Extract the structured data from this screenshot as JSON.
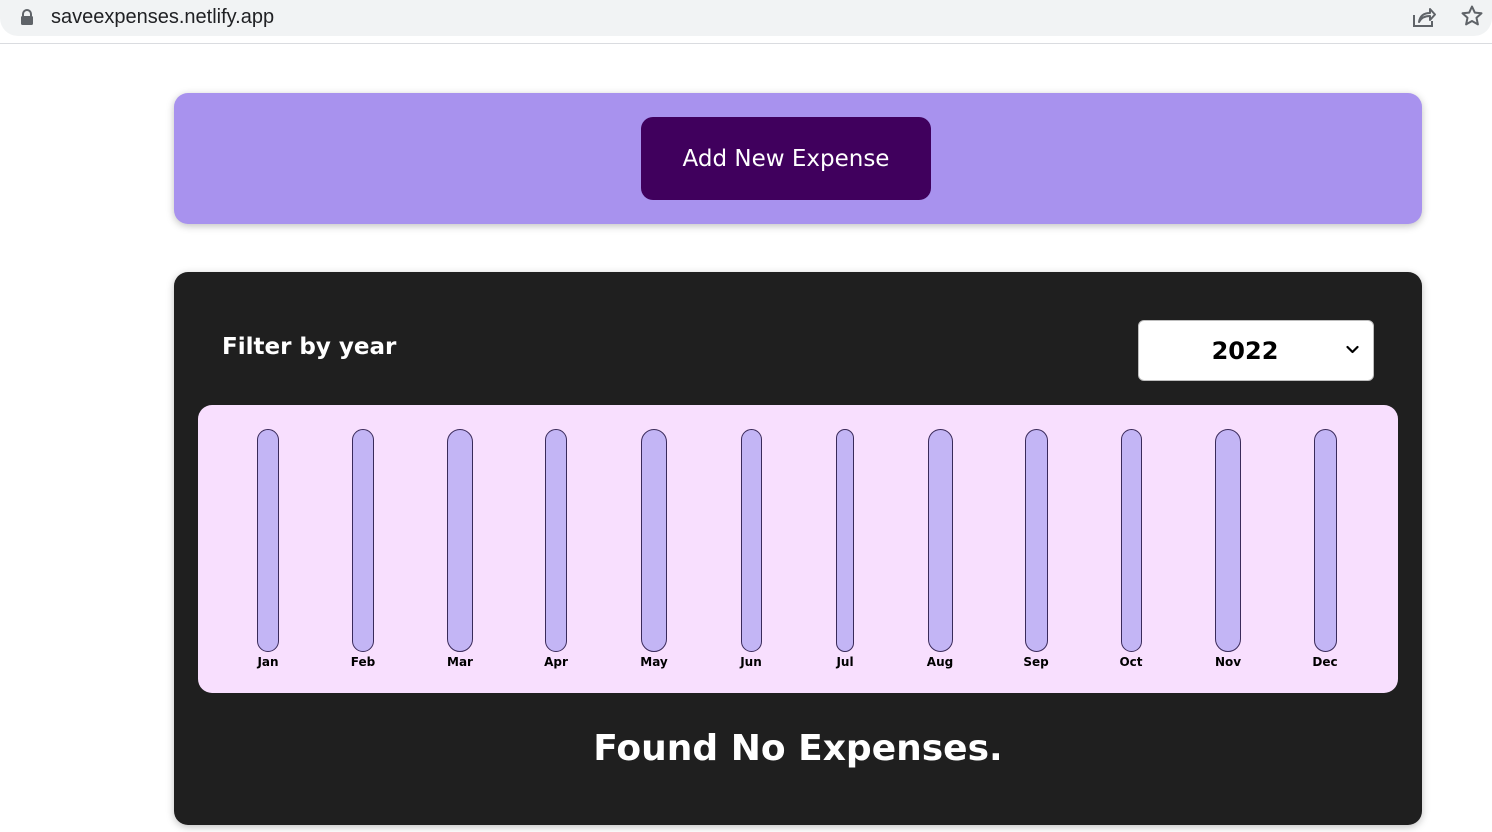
{
  "browser": {
    "url": "saveexpenses.netlify.app"
  },
  "new_expense": {
    "button_label": "Add New Expense",
    "panel_color": "#a892ee",
    "button_color": "#40005d"
  },
  "expenses": {
    "filter_label": "Filter by year",
    "selected_year": "2022",
    "empty_message": "Found No Expenses."
  },
  "chart_data": {
    "type": "bar",
    "categories": [
      "Jan",
      "Feb",
      "Mar",
      "Apr",
      "May",
      "Jun",
      "Jul",
      "Aug",
      "Sep",
      "Oct",
      "Nov",
      "Dec"
    ],
    "values": [
      0,
      0,
      0,
      0,
      0,
      0,
      0,
      0,
      0,
      0,
      0,
      0
    ],
    "title": "",
    "xlabel": "",
    "ylabel": "",
    "grid": false
  },
  "icons": {
    "lock": "lock-icon",
    "share": "share-icon",
    "star": "star-icon",
    "dropdown": "chevron-down-icon"
  }
}
